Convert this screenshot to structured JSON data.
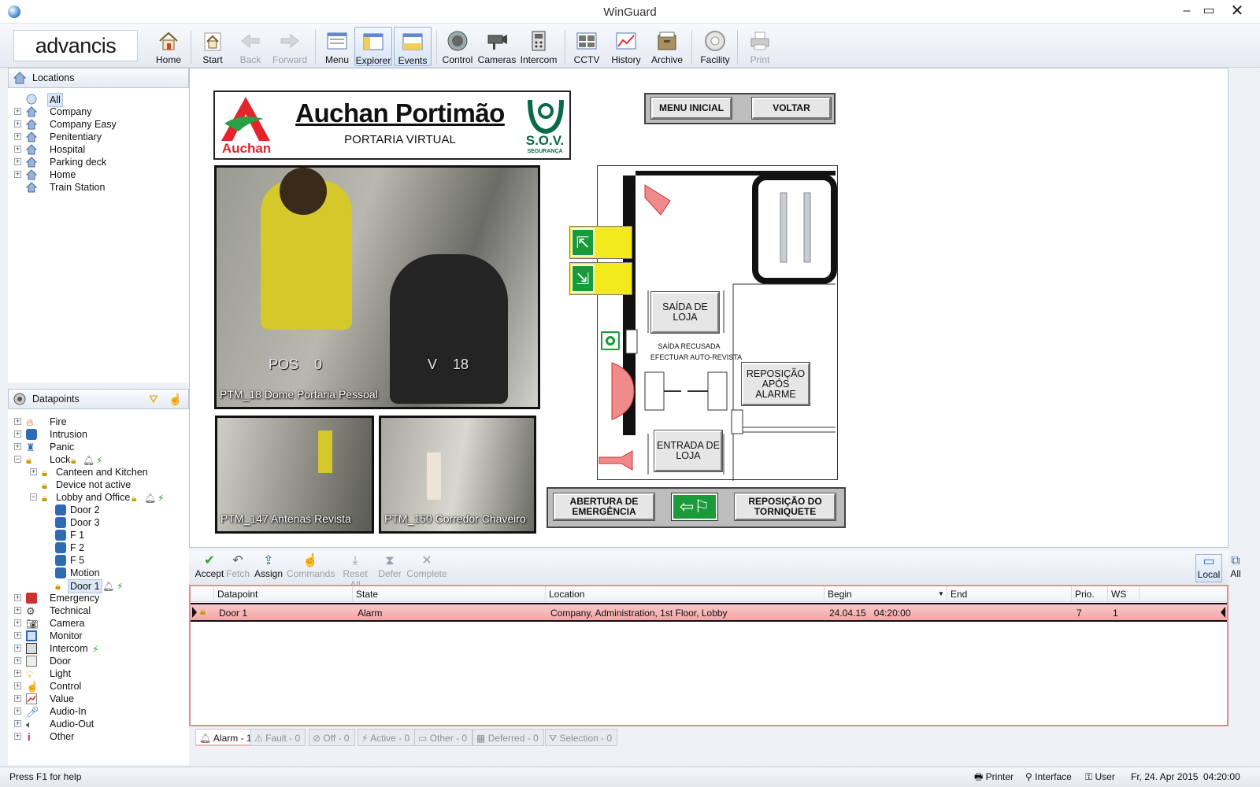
{
  "window": {
    "title": "WinGuard"
  },
  "toolbar": {
    "logo": "advancis",
    "buttons": [
      {
        "label": "Home",
        "icon": "house-icon",
        "enabled": true
      },
      {
        "label": "Start",
        "icon": "start-house-icon",
        "enabled": true
      },
      {
        "label": "Back",
        "icon": "arrow-left-icon",
        "enabled": false
      },
      {
        "label": "Forward",
        "icon": "arrow-right-icon",
        "enabled": false
      },
      {
        "label": "Menu",
        "icon": "menu-window-icon",
        "enabled": true
      },
      {
        "label": "Explorer",
        "icon": "explorer-window-icon",
        "enabled": true,
        "active": true
      },
      {
        "label": "Events",
        "icon": "events-window-icon",
        "enabled": true,
        "active": true
      },
      {
        "label": "Control",
        "icon": "control-knob-icon",
        "enabled": true
      },
      {
        "label": "Cameras",
        "icon": "camera-icon",
        "enabled": true
      },
      {
        "label": "Intercom",
        "icon": "intercom-icon",
        "enabled": true
      },
      {
        "label": "CCTV",
        "icon": "cctv-grid-icon",
        "enabled": true
      },
      {
        "label": "History",
        "icon": "history-chart-icon",
        "enabled": true
      },
      {
        "label": "Archive",
        "icon": "archive-box-icon",
        "enabled": true
      },
      {
        "label": "Facility",
        "icon": "facility-gear-icon",
        "enabled": true
      },
      {
        "label": "Print",
        "icon": "printer-icon",
        "enabled": false
      }
    ]
  },
  "locations": {
    "title": "Locations",
    "items": [
      "All",
      "Company",
      "Company Easy",
      "Penitentiary",
      "Hospital",
      "Parking deck",
      "Home",
      "Train Station"
    ],
    "selected": "All"
  },
  "datapoints": {
    "title": "Datapoints",
    "items": [
      "Fire",
      "Intrusion",
      "Panic",
      "Lock",
      "Canteen and Kitchen",
      "Device not active",
      "Lobby and Office",
      "Door 2",
      "Door 3",
      "F 1",
      "F 2",
      "F 5",
      "Motion",
      "Door 1",
      "Emergency",
      "Technical",
      "Camera",
      "Monitor",
      "Intercom",
      "Door",
      "Light",
      "Control",
      "Value",
      "Audio-In",
      "Audio-Out",
      "Other"
    ],
    "selected": "Door 1"
  },
  "content": {
    "header_title": "Auchan Portimão",
    "header_subtitle": "PORTARIA VIRTUAL",
    "auchan_logo": "Auchan",
    "sov_logo": "S.O.V.",
    "sov_sub": "SEGURANÇA",
    "btn_menu": "MENU INICIAL",
    "btn_voltar": "VOLTAR",
    "cam1": "PTM_18 Dome Portaria Pessoal",
    "cam1_osd_pos": "POS    0",
    "cam1_osd_v": "V    18",
    "cam2": "PTM_147 Antenas Revista",
    "cam3": "PTM_150 Corredor Chaveiro",
    "saida": "SAÍDA DE LOJA",
    "recusada1": "SAÍDA RECUSADA",
    "recusada2": "EFECTUAR AUTO-REVISTA",
    "reposicao": "REPOSIÇÃO APÓS ALARME",
    "entrada": "ENTRADA DE LOJA",
    "abertura": "ABERTURA DE EMERGÊNCIA",
    "torniquete": "REPOSIÇÃO DO TORNIQUETE"
  },
  "alarm_toolbar": {
    "actions": [
      {
        "label": "Accept",
        "icon": "check-icon",
        "enabled": true
      },
      {
        "label": "Fetch",
        "icon": "fetch-arrow-icon",
        "enabled": false
      },
      {
        "label": "Assign",
        "icon": "assign-icon",
        "enabled": true
      },
      {
        "label": "Commands",
        "icon": "hand-pointer-icon",
        "enabled": false
      },
      {
        "label": "Reset All",
        "icon": "reset-all-icon",
        "enabled": false
      },
      {
        "label": "Defer",
        "icon": "defer-icon",
        "enabled": false
      },
      {
        "label": "Complete",
        "icon": "x-icon",
        "enabled": false
      }
    ],
    "local": "Local",
    "all": "All"
  },
  "alarm_grid": {
    "columns": [
      "Datapoint",
      "State",
      "Location",
      "Begin",
      "End",
      "Prio.",
      "WS"
    ],
    "rows": [
      {
        "datapoint": "Door 1",
        "state": "Alarm",
        "location": "Company, Administration, 1st Floor, Lobby",
        "begin": "24.04.15   04:20:00",
        "end": "",
        "prio": "7",
        "ws": "1"
      }
    ]
  },
  "tabs": [
    "Alarm - 1",
    "Fault - 0",
    "Off - 0",
    "Active - 0",
    "Other - 0",
    "Deferred - 0",
    "Selection - 0"
  ],
  "statusbar": {
    "help": "Press F1 for help",
    "printer": "Printer",
    "interface": "Interface",
    "user": "User",
    "datetime": "Fr, 24. Apr 2015  04:20:00"
  },
  "colors": {
    "alarm_row": "#f4a5a5",
    "accent": "#2f6bb5",
    "emergency_green": "#1a9b3a",
    "sign_yellow": "#f2ea1c"
  }
}
